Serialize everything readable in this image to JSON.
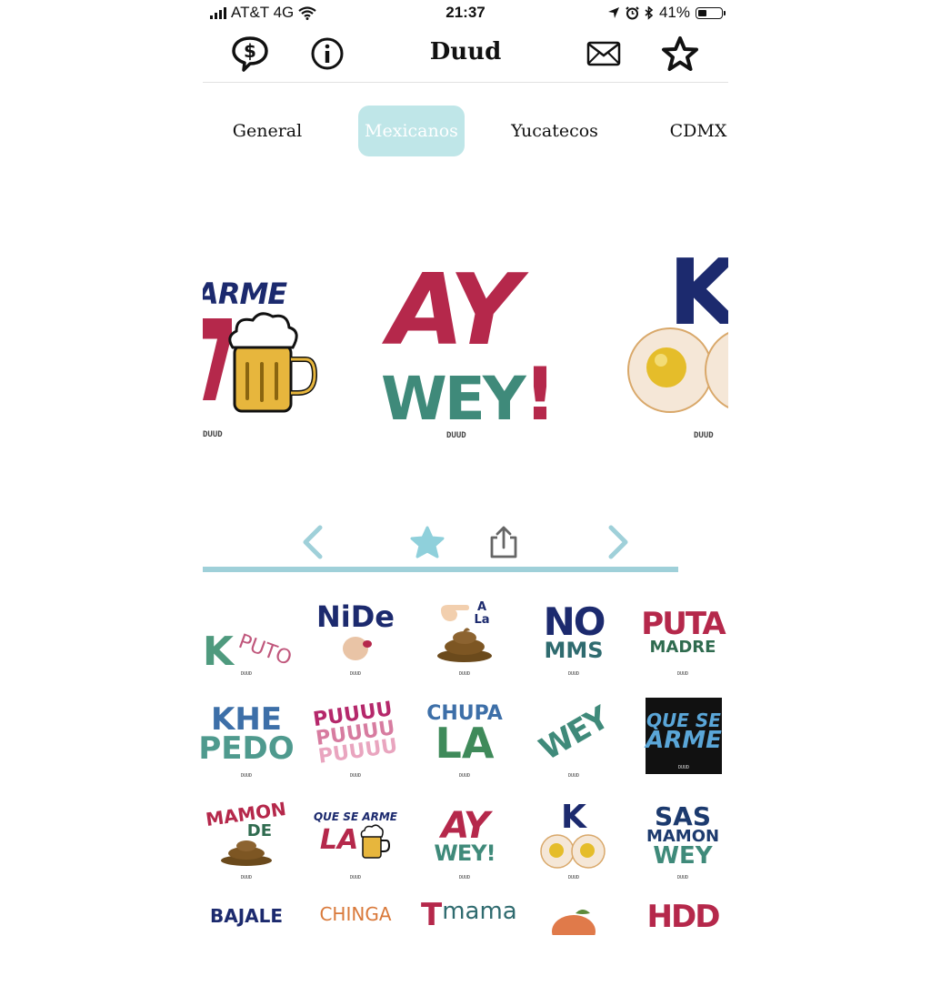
{
  "status_bar": {
    "carrier": "AT&T 4G",
    "time": "21:37",
    "battery": "41%",
    "battery_level": 0.41
  },
  "header": {
    "title": "Duud"
  },
  "tabs": [
    {
      "label": "General",
      "active": false
    },
    {
      "label": "Mexicanos",
      "active": true
    },
    {
      "label": "Yucatecos",
      "active": false
    },
    {
      "label": "CDMX",
      "active": false
    }
  ],
  "carousel": {
    "slides": [
      {
        "id": "que-se-arme",
        "text": "SE ARME",
        "watermark": "DUUD"
      },
      {
        "id": "ay-wey",
        "line1": "AY",
        "line2": "WEY",
        "exclaim": "!",
        "watermark": "DUUD"
      },
      {
        "id": "k-eggs",
        "text": "K",
        "watermark": "DUUD"
      }
    ]
  },
  "stickers": [
    {
      "lines": [
        "K",
        "PUTO"
      ]
    },
    {
      "lines": [
        "NiDe"
      ]
    },
    {
      "lines": [
        "A",
        "La"
      ]
    },
    {
      "lines": [
        "NO",
        "MMS"
      ]
    },
    {
      "lines": [
        "PUTA",
        "MADRE"
      ]
    },
    {
      "lines": [
        "KHE",
        "PEDO"
      ]
    },
    {
      "lines": [
        "PUUUU",
        "PUUUU",
        "PUUUU"
      ]
    },
    {
      "lines": [
        "CHUPA",
        "LA"
      ]
    },
    {
      "lines": [
        "WEY"
      ]
    },
    {
      "lines": [
        "QUE SE",
        "ARME"
      ]
    },
    {
      "lines": [
        "MAMON",
        "DE"
      ]
    },
    {
      "lines": [
        "QUE SE ARME",
        "LA"
      ]
    },
    {
      "lines": [
        "AY",
        "WEY!"
      ]
    },
    {
      "lines": [
        "K"
      ]
    },
    {
      "lines": [
        "SAS",
        "MAMON",
        "WEY"
      ]
    },
    {
      "lines": [
        "BAJALE"
      ]
    },
    {
      "lines": [
        "CHINGA"
      ]
    },
    {
      "lines": [
        "T",
        "mama"
      ]
    },
    {
      "lines": [
        ""
      ]
    },
    {
      "lines": [
        "HDD"
      ]
    }
  ],
  "sticker_watermark": "DUUD",
  "colors": {
    "accent": "#9fd0d9",
    "tab_active_bg": "#bfe6e8",
    "crimson": "#b5284b",
    "navy": "#1c2a6e",
    "teal": "#3f8a7a"
  }
}
